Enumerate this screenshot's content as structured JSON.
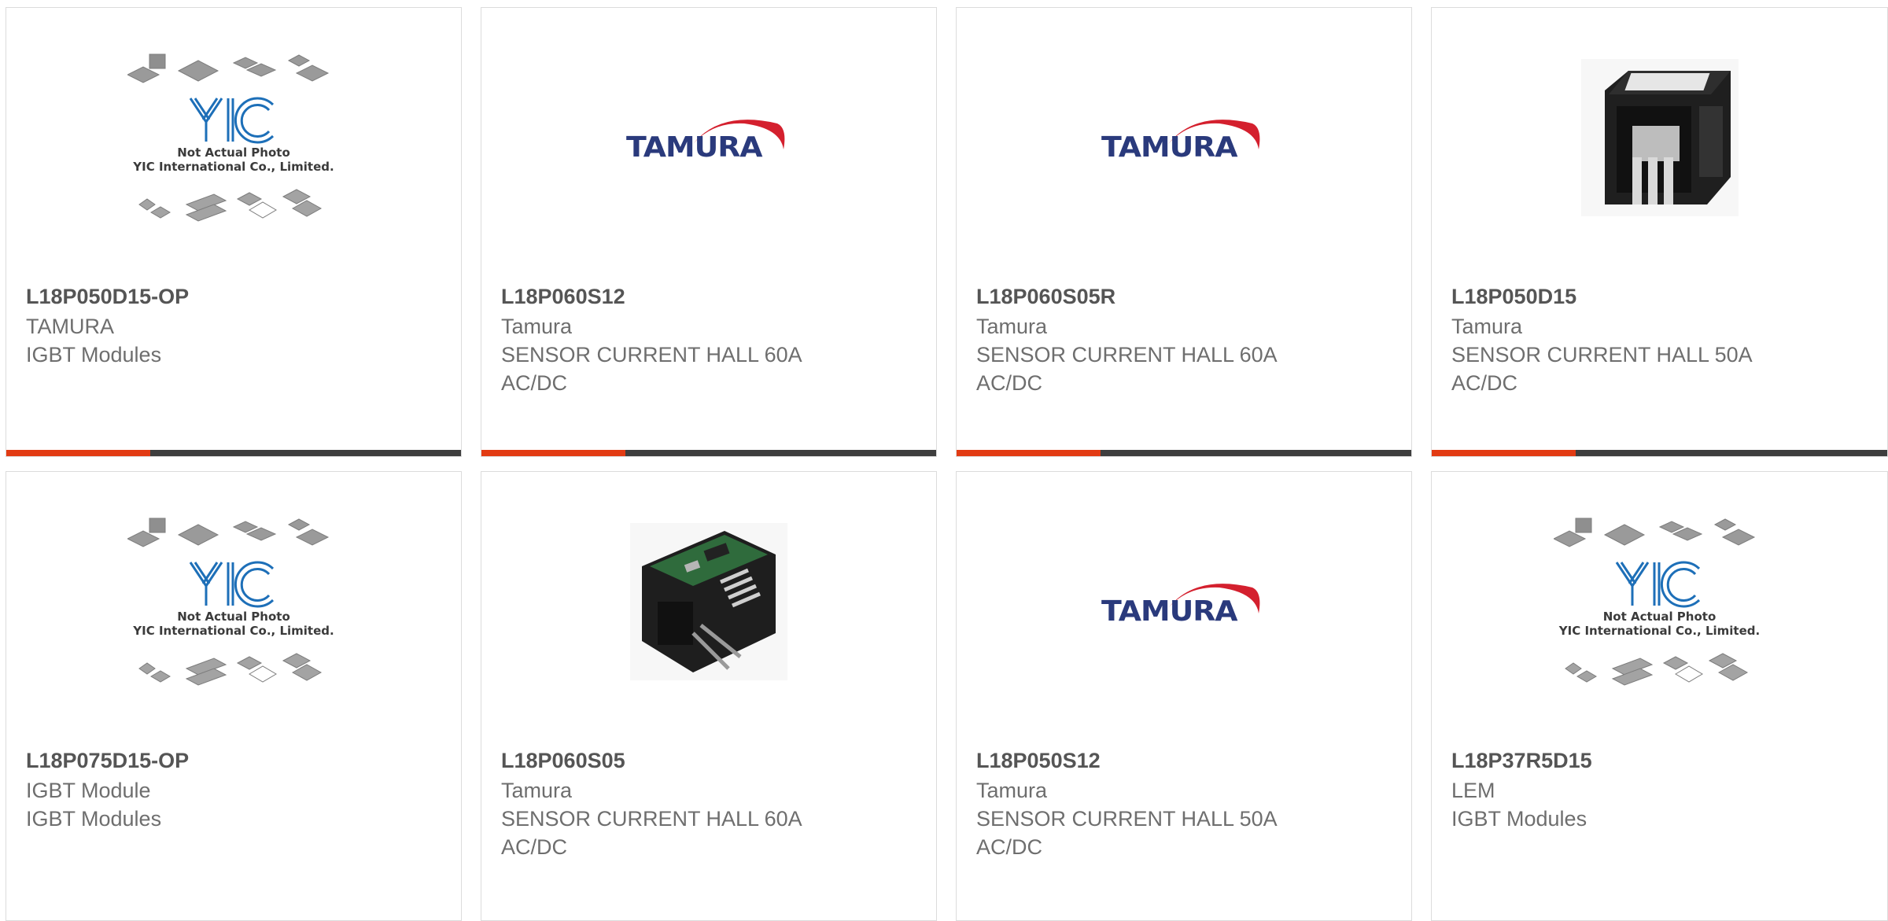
{
  "products": [
    {
      "part": "L18P050D15-OP",
      "line1": "TAMURA",
      "line2": "IGBT Modules",
      "line3": "",
      "image": "yic-placeholder",
      "image_caption_1": "Not Actual Photo",
      "image_caption_2": "YIC International Co., Limited."
    },
    {
      "part": "L18P060S12",
      "line1": "Tamura",
      "line2": "SENSOR CURRENT HALL 60A",
      "line3": "AC/DC",
      "image": "tamura-logo"
    },
    {
      "part": "L18P060S05R",
      "line1": "Tamura",
      "line2": "SENSOR CURRENT HALL 60A",
      "line3": "AC/DC",
      "image": "tamura-logo"
    },
    {
      "part": "L18P050D15",
      "line1": "Tamura",
      "line2": "SENSOR CURRENT HALL 50A",
      "line3": "AC/DC",
      "image": "sensor-photo"
    },
    {
      "part": "L18P075D15-OP",
      "line1": "IGBT Module",
      "line2": "IGBT Modules",
      "line3": "",
      "image": "yic-placeholder",
      "image_caption_1": "Not Actual Photo",
      "image_caption_2": "YIC International Co., Limited."
    },
    {
      "part": "L18P060S05",
      "line1": "Tamura",
      "line2": "SENSOR CURRENT HALL 60A",
      "line3": "AC/DC",
      "image": "sensor-board-photo"
    },
    {
      "part": "L18P050S12",
      "line1": "Tamura",
      "line2": "SENSOR CURRENT HALL 50A",
      "line3": "AC/DC",
      "image": "tamura-logo"
    },
    {
      "part": "L18P37R5D15",
      "line1": "LEM",
      "line2": "IGBT Modules",
      "line3": "",
      "image": "yic-placeholder",
      "image_caption_1": "Not Actual Photo",
      "image_caption_2": "YIC International Co., Limited."
    }
  ],
  "logo_text": {
    "tamura": "TAMURA",
    "yic": "YIC"
  },
  "colors": {
    "accent": "#e23b13",
    "bar": "#3e3e3e",
    "border": "#dcdcdc",
    "title": "#555555",
    "text": "#6e6e6e",
    "tamura_blue": "#2a3a7c",
    "tamura_red": "#d4202e",
    "yic_blue": "#1d6fb8"
  }
}
